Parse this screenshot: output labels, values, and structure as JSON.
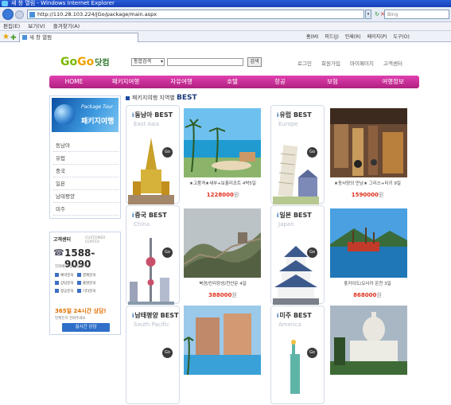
{
  "browser": {
    "title": "새 창 열림 - Windows Internet Explorer",
    "address": "http://110.28.103.224/jGo/package/main.aspx",
    "search_placeholder": "Bing",
    "menu": [
      "편집(E)",
      "보기(V)",
      "즐겨찾기(A)"
    ],
    "tab_title": "새 창 열림",
    "commands": [
      "홈(M)",
      "피드(J)",
      "인쇄(R)",
      "페이지(P)",
      "도구(O)"
    ]
  },
  "site": {
    "logo_a": "Go",
    "logo_b": "Go",
    "logo_c": "닷컴",
    "search_select": "통합검색",
    "search_button": "검색",
    "top_links": [
      "로그인",
      "회원가입",
      "마이페이지",
      "고객센터"
    ],
    "gnb": [
      "HOME",
      "패키지여행",
      "자유여행",
      "호텔",
      "항공",
      "보험",
      "여행정보"
    ]
  },
  "sidebar": {
    "banner_en": "Package Tour",
    "banner_kr": "패키지여행",
    "menu": [
      "동남아",
      "유럽",
      "중국",
      "일본",
      "남태평양",
      "미주"
    ]
  },
  "customer_center": {
    "title": "고객센터",
    "subtitle": "CUSTOMER CENTER",
    "phone": "1588-9090",
    "note": "전화예약 및 상담 문의",
    "rows": [
      "예약문의",
      "결제문의",
      "상담문의",
      "출발문의",
      "항공문의",
      "기타문의"
    ],
    "consult": "365일 24시간 상담!",
    "consult_sub": "언제든지 전화주세요",
    "consult_button": "실시간 상담"
  },
  "section": {
    "prefix": "패키지여행 지역별",
    "title": "BEST"
  },
  "regions": [
    {
      "name": "동남아",
      "en": "East Asia",
      "caption": "★고품격★세부+보홀리조트 4박5일",
      "price": "1228000",
      "unit": "원"
    },
    {
      "name": "유럽",
      "en": "Europe",
      "caption": "★동서양의 만남★ 그리스+터키 9일",
      "price": "1590000",
      "unit": "원"
    },
    {
      "name": "중국",
      "en": "China",
      "caption": "북경/만리장성/천안문 4일",
      "price": "388000",
      "unit": "원"
    },
    {
      "name": "일본",
      "en": "Japan",
      "caption": "홋카이도/오사카 온천 3일",
      "price": "868000",
      "unit": "원"
    },
    {
      "name": "남태평양",
      "en": "South Pacific",
      "caption": "",
      "price": "",
      "unit": ""
    },
    {
      "name": "미주",
      "en": "America",
      "caption": "",
      "price": "",
      "unit": ""
    }
  ],
  "label_best": "BEST",
  "label_go": "Go"
}
